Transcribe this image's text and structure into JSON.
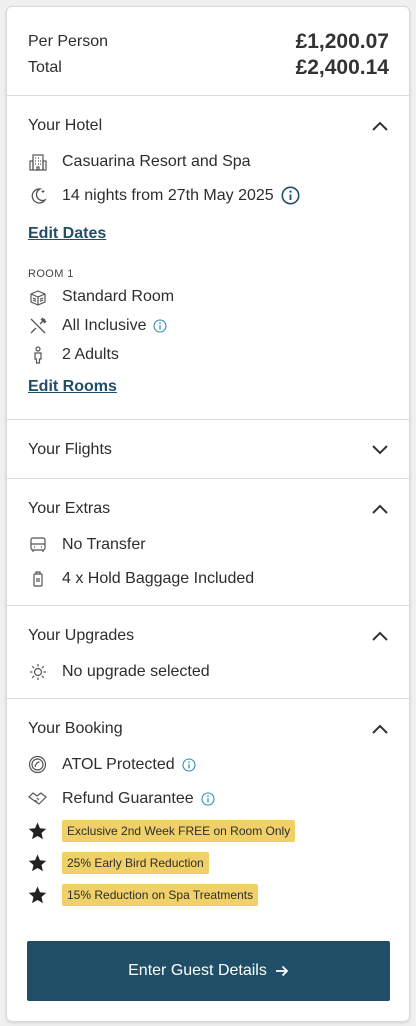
{
  "price": {
    "per_person_label": "Per Person",
    "per_person_value": "£1,200.07",
    "total_label": "Total",
    "total_value": "£2,400.14"
  },
  "hotel": {
    "title": "Your Hotel",
    "name": "Casuarina Resort and Spa",
    "dates": "14 nights from 27th May 2025",
    "edit_dates": "Edit Dates",
    "room_label": "ROOM 1",
    "room_type": "Standard Room",
    "board": "All Inclusive",
    "guests": "2 Adults",
    "edit_rooms": "Edit Rooms"
  },
  "flights": {
    "title": "Your Flights"
  },
  "extras": {
    "title": "Your Extras",
    "transfer": "No Transfer",
    "baggage": "4 x Hold Baggage Included"
  },
  "upgrades": {
    "title": "Your Upgrades",
    "status": "No upgrade selected"
  },
  "booking": {
    "title": "Your Booking",
    "atol": "ATOL Protected",
    "refund": "Refund Guarantee",
    "offers": [
      "Exclusive 2nd Week FREE on Room Only",
      "25% Early Bird Reduction",
      "15% Reduction on Spa Treatments"
    ]
  },
  "cta": {
    "label": "Enter Guest Details"
  },
  "colors": {
    "accent": "#1f4e66",
    "badge": "#f0d068",
    "info": "#2b8fb6"
  }
}
